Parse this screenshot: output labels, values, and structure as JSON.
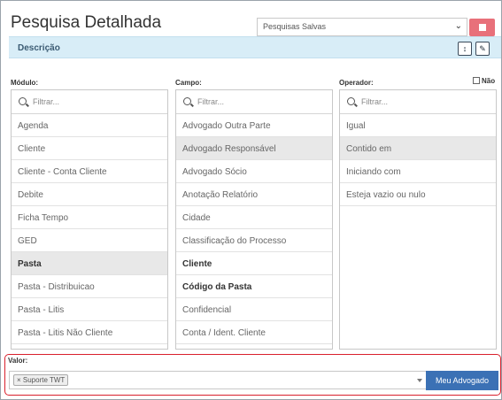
{
  "header": {
    "title": "Pesquisa Detalhada",
    "saved_searches": "Pesquisas Salvas"
  },
  "description_bar": {
    "label": "Descrição"
  },
  "modulo": {
    "label": "Módulo:",
    "filter_placeholder": "Filtrar...",
    "items": [
      "Agenda",
      "Cliente",
      "Cliente - Conta Cliente",
      "Debite",
      "Ficha Tempo",
      "GED",
      "Pasta",
      "Pasta - Distribuicao",
      "Pasta - Litis",
      "Pasta - Litis Não Cliente"
    ]
  },
  "campo": {
    "label": "Campo:",
    "filter_placeholder": "Filtrar...",
    "items": [
      "Advogado Outra Parte",
      "Advogado Responsável",
      "Advogado Sócio",
      "Anotação Relatório",
      "Cidade",
      "Classificação do Processo",
      "Cliente",
      "Código da Pasta",
      "Confidencial",
      "Conta / Ident. Cliente"
    ]
  },
  "operador": {
    "label": "Operador:",
    "nao_label": "Não",
    "filter_placeholder": "Filtrar...",
    "items": [
      "Igual",
      "Contido em",
      "Iniciando com",
      "Esteja vazio ou nulo"
    ]
  },
  "valor": {
    "label": "Valor:",
    "tag": "× Suporte TWT",
    "button": "Meu Advogado"
  }
}
